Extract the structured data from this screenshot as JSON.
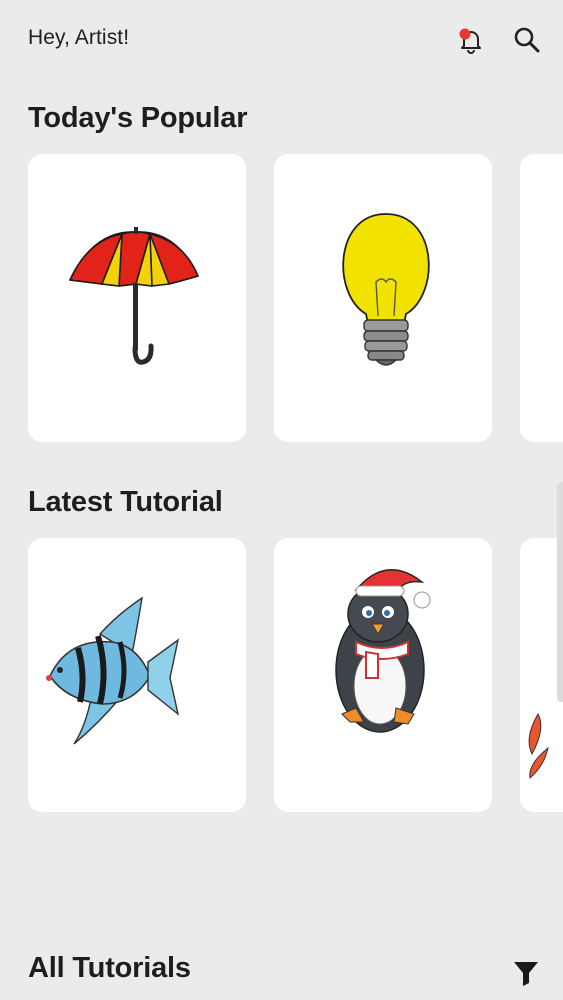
{
  "header": {
    "greeting": "Hey, Artist!",
    "notification_icon": "bell-with-red-dot-icon",
    "search_icon": "search-icon"
  },
  "sections": {
    "popular_title": "Today's Popular",
    "latest_title": "Latest Tutorial",
    "all_title": "All Tutorials"
  },
  "popular_items": [
    {
      "subject": "umbrella"
    },
    {
      "subject": "light bulb"
    },
    {
      "subject": "partially visible"
    }
  ],
  "latest_items": [
    {
      "subject": "angelfish"
    },
    {
      "subject": "penguin in santa hat"
    },
    {
      "subject": "partially visible"
    }
  ],
  "colors": {
    "background": "#ecebec",
    "card": "#ffffff",
    "notification_dot": "#e53935",
    "text": "#1f1f1f"
  },
  "filter_icon": "filter-funnel-icon"
}
